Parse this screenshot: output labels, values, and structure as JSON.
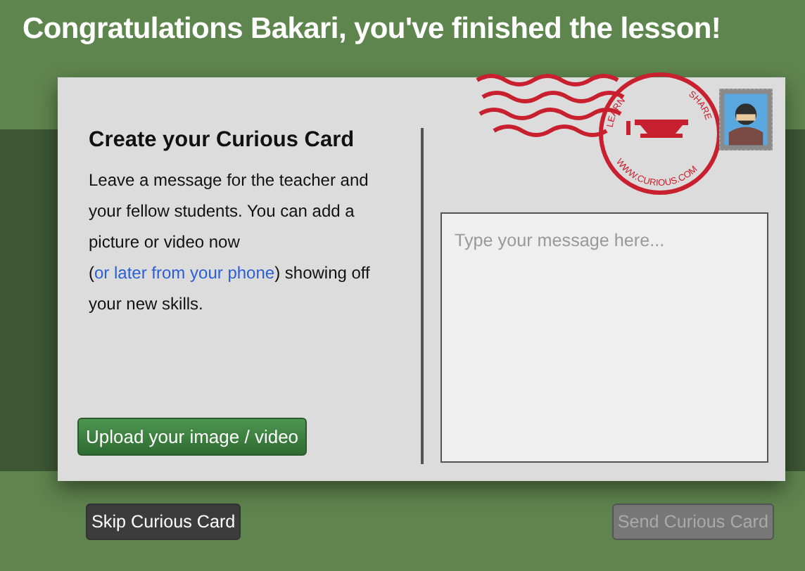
{
  "heading": "Congratulations Bakari, you've finished the lesson!",
  "card": {
    "title": "Create your Curious Card",
    "message_parts": [
      {
        "kind": "text",
        "text": "Leave a message for the teacher and your fellow students. You can add a picture or video now ("
      },
      {
        "kind": "link",
        "text": "or later from your phone"
      },
      {
        "kind": "text",
        "text": ") showing off your new skills."
      }
    ],
    "upload_button": "Upload your image / video",
    "message_field": {
      "placeholder": "Type your message here..."
    },
    "postmark_text": [
      "LEARN",
      "SHARE",
      "WWW.CURIOUS.COM"
    ]
  },
  "buttons": [
    {
      "kind": "skip",
      "label": "Skip Curious Card",
      "disabled": false
    },
    {
      "kind": "send",
      "label": "Send Curious Card",
      "disabled": true
    }
  ]
}
